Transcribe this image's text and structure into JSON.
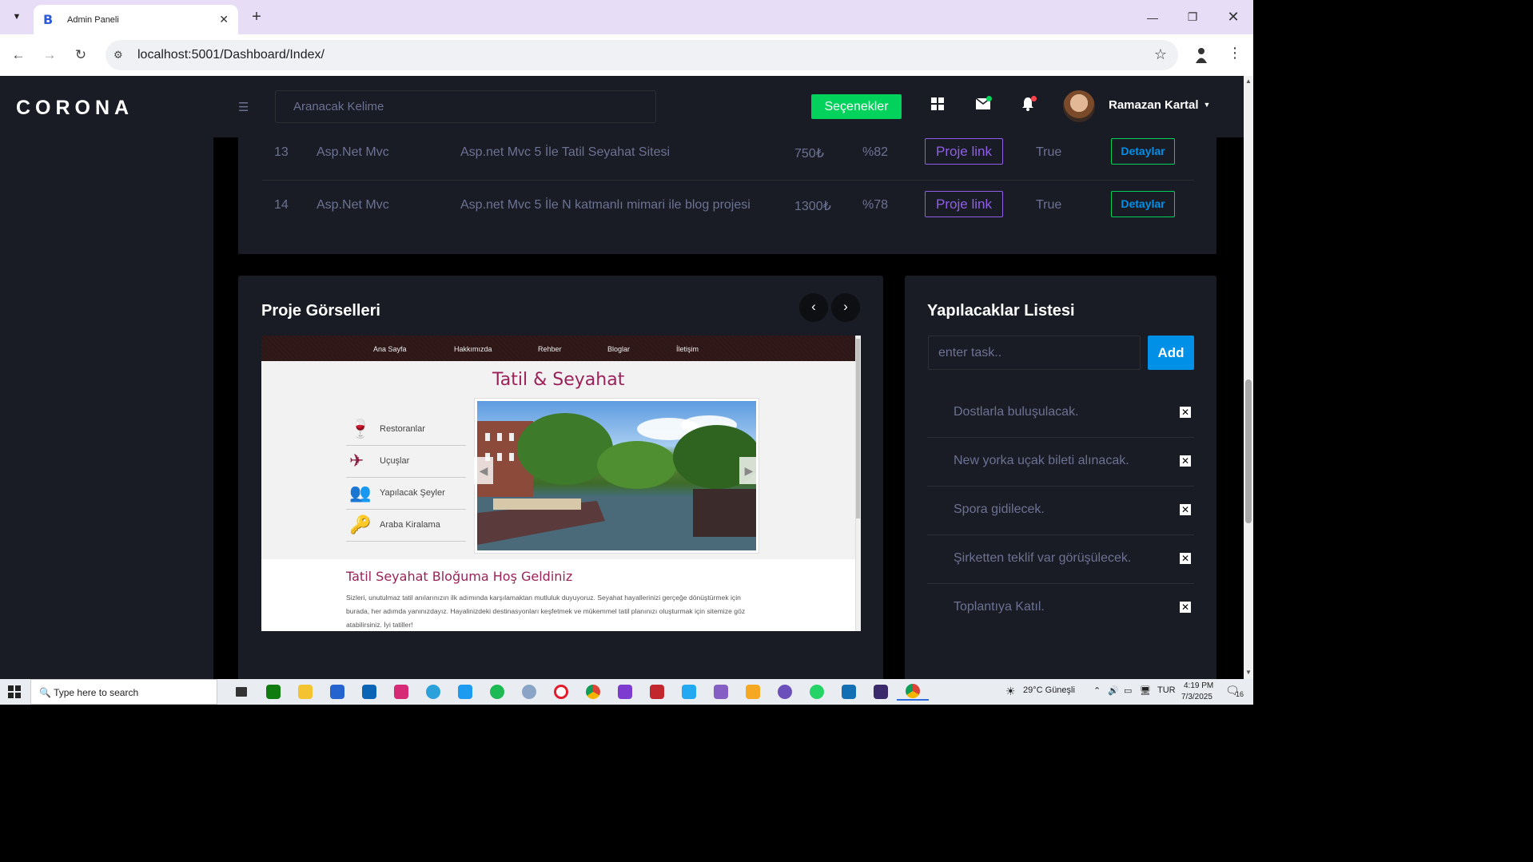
{
  "browser": {
    "tab_title": "Admin Paneli",
    "tab_favicon": "B",
    "url": "localhost:5001/Dashboard/Index/"
  },
  "header": {
    "brand": "CORONA",
    "search_placeholder": "Aranacak Kelime",
    "options_label": "Seçenekler",
    "user_name": "Ramazan Kartal"
  },
  "projects": {
    "rows": [
      {
        "id": "13",
        "category": "Asp.Net Mvc",
        "name": "Asp.net Mvc 5 İle Tatil Seyahat Sitesi",
        "price": "750₺",
        "progress": "%82",
        "link": "Proje link",
        "status": "True",
        "details": "Detaylar"
      },
      {
        "id": "14",
        "category": "Asp.Net Mvc",
        "name": "Asp.net Mvc 5 İle N katmanlı mimari ile blog projesi",
        "price": "1300₺",
        "progress": "%78",
        "link": "Proje link",
        "status": "True",
        "details": "Detaylar"
      }
    ]
  },
  "gallery": {
    "title": "Proje Görselleri",
    "site": {
      "nav": [
        "Ana Sayfa",
        "Hakkımızda",
        "Rehber",
        "Bloglar",
        "İletişim"
      ],
      "title": "Tatil & Seyahat",
      "menu": [
        "Restoranlar",
        "Uçuşlar",
        "Yapılacak Şeyler",
        "Araba Kiralama"
      ],
      "welcome": "Tatil Seyahat Bloğuma Hoş Geldiniz",
      "text": "Sizleri, unutulmaz tatil anılarınızın ilk adımında karşılamaktan mutluluk duyuyoruz. Seyahat hayallerinizi gerçeğe dönüştürmek için burada, her adımda yanınızdayız. Hayalinizdeki destinasyonları keşfetmek ve mükemmel tatil planınızı oluşturmak için sitemize göz atabilirsiniz. İyi tatiller!"
    }
  },
  "todo": {
    "title": "Yapılacaklar Listesi",
    "input_placeholder": "enter task..",
    "add_label": "Add",
    "items": [
      "Dostlarla buluşulacak.",
      "New yorka uçak bileti alınacak.",
      "Spora gidilecek.",
      "Şirketten teklif var görüşülecek.",
      "Toplantıya Katıl."
    ]
  },
  "taskbar": {
    "search_placeholder": "Type here to search",
    "weather": "29°C  Güneşli",
    "lang": "TUR",
    "time": "4:19 PM",
    "date": "7/3/2025",
    "notif_count": "16"
  }
}
